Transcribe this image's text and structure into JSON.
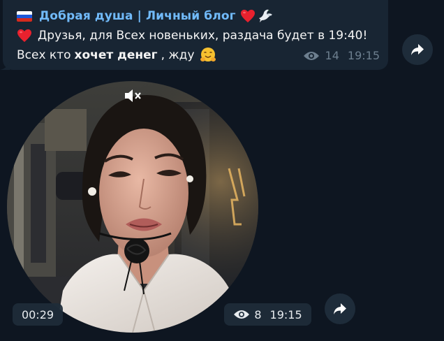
{
  "post": {
    "channel_name": "Добрая душа | Личный блог",
    "line1": "Друзья, для Всех новеньких, раздача будет в 19:40!",
    "line2_start": "Всех кто",
    "line2_bold": "хочет денег",
    "line2_end": ", жду",
    "views": "14",
    "time": "19:15"
  },
  "video_message": {
    "duration": "00:29",
    "views": "8",
    "time": "19:15"
  },
  "colors": {
    "background": "#0e1621",
    "bubble": "#182533",
    "channel_name": "#71bafa",
    "meta": "#6d7f8f"
  },
  "icons": [
    "russia-flag-icon",
    "red-heart-icon",
    "dove-icon",
    "hugging-face-icon",
    "eye-icon",
    "forward-icon",
    "muted-speaker-icon"
  ]
}
